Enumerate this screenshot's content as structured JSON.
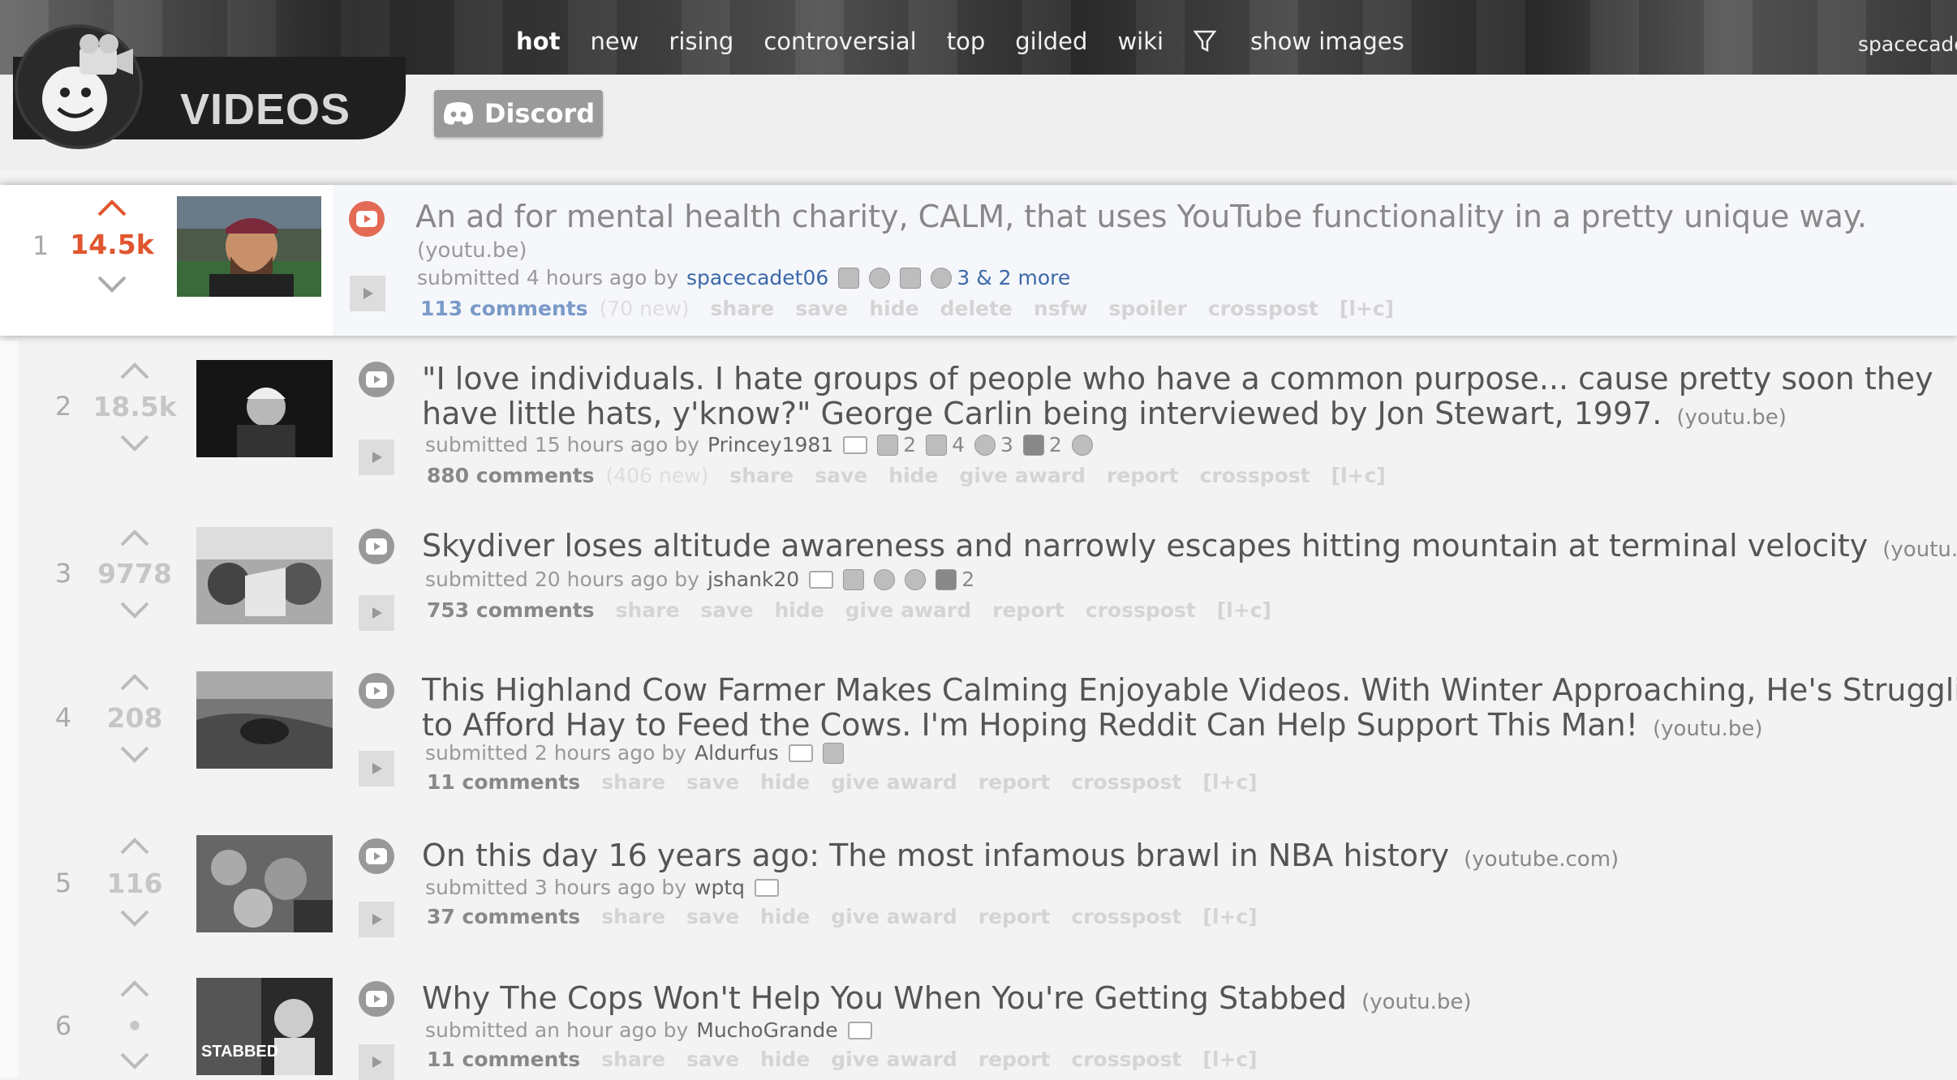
{
  "header": {
    "tabs": [
      {
        "label": "hot",
        "selected": true
      },
      {
        "label": "new"
      },
      {
        "label": "rising"
      },
      {
        "label": "controversial"
      },
      {
        "label": "top"
      },
      {
        "label": "gilded"
      },
      {
        "label": "wiki"
      }
    ],
    "filter_icon": "funnel-icon",
    "show_images_label": "show images",
    "user": "spacecade"
  },
  "subreddit": {
    "title": "VIDEOS",
    "discord_label": "Discord"
  },
  "posts": [
    {
      "rank": "1",
      "score": "14.5k",
      "title": "An ad for mental health charity, CALM, that uses YouTube functionality in a pretty unique way.",
      "domain": "(youtu.be)",
      "submitted": "submitted 4 hours ago by",
      "author": "spacecadet06",
      "awards": [
        {
          "count": ""
        },
        {
          "count": ""
        },
        {
          "count": ""
        },
        {
          "count": "3"
        }
      ],
      "more": "& 2 more",
      "comments": "113 comments",
      "new_comments": "(70 new)",
      "buttons": [
        "share",
        "save",
        "hide",
        "delete",
        "nsfw",
        "spoiler",
        "crosspost",
        "[l+c]"
      ]
    },
    {
      "rank": "2",
      "score": "18.5k",
      "title_line1": "\"I love individuals. I hate groups of people who have a common purpose... cause pretty soon they",
      "title_line2": "have little hats, y'know?\" George Carlin being interviewed by Jon Stewart, 1997.",
      "domain": "(youtu.be)",
      "submitted": "submitted 15 hours ago by",
      "author": "Princey1981",
      "awards": [
        {
          "count": "2"
        },
        {
          "count": "4"
        },
        {
          "count": "3"
        },
        {
          "count": "2"
        },
        {
          "count": ""
        }
      ],
      "comments": "880 comments",
      "new_comments": "(406 new)",
      "buttons": [
        "share",
        "save",
        "hide",
        "give award",
        "report",
        "crosspost",
        "[l+c]"
      ]
    },
    {
      "rank": "3",
      "score": "9778",
      "title": "Skydiver loses altitude awareness and narrowly escapes hitting mountain at terminal velocity",
      "domain": "(youtu.be)",
      "submitted": "submitted 20 hours ago by",
      "author": "jshank20",
      "awards": [
        {
          "count": ""
        },
        {
          "count": ""
        },
        {
          "count": ""
        },
        {
          "count": "2"
        }
      ],
      "comments": "753 comments",
      "buttons": [
        "share",
        "save",
        "hide",
        "give award",
        "report",
        "crosspost",
        "[l+c]"
      ]
    },
    {
      "rank": "4",
      "score": "208",
      "title_line1": "This Highland Cow Farmer Makes Calming Enjoyable Videos. With Winter Approaching, He's Struggling",
      "title_line2": "to Afford Hay to Feed the Cows. I'm Hoping Reddit Can Help Support This Man!",
      "domain": "(youtu.be)",
      "submitted": "submitted 2 hours ago by",
      "author": "Aldurfus",
      "comments": "11 comments",
      "buttons": [
        "share",
        "save",
        "hide",
        "give award",
        "report",
        "crosspost",
        "[l+c]"
      ]
    },
    {
      "rank": "5",
      "score": "116",
      "title": "On this day 16 years ago: The most infamous brawl in NBA history",
      "domain": "(youtube.com)",
      "submitted": "submitted 3 hours ago by",
      "author": "wptq",
      "comments": "37 comments",
      "buttons": [
        "share",
        "save",
        "hide",
        "give award",
        "report",
        "crosspost",
        "[l+c]"
      ]
    },
    {
      "rank": "6",
      "score": "•",
      "title": "Why The Cops Won't Help You When You're Getting Stabbed",
      "domain": "(youtu.be)",
      "submitted": "submitted an hour ago by",
      "author": "MuchoGrande",
      "thumb_text": "STABBED",
      "comments": "11 comments",
      "buttons": [
        "share",
        "save",
        "hide",
        "give award",
        "report",
        "crosspost",
        "[l+c]"
      ]
    }
  ],
  "colors": {
    "upvoted_score": "#e0562e",
    "link_blue": "#3b68a8",
    "media_red": "#e36a55"
  }
}
